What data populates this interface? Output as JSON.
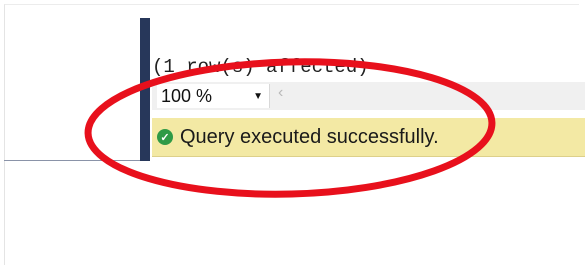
{
  "results": {
    "message": "(1 row(s) affected)"
  },
  "zoom": {
    "value": "100 %",
    "arrow_icon": "dropdown-arrow-icon",
    "scroll_icon": "scroll-left-icon"
  },
  "status": {
    "icon": "success-check-icon",
    "text": "Query executed successfully.",
    "background": "#f3e9a4",
    "icon_color": "#2f9a46"
  },
  "annotation": {
    "color": "#e8101c"
  }
}
